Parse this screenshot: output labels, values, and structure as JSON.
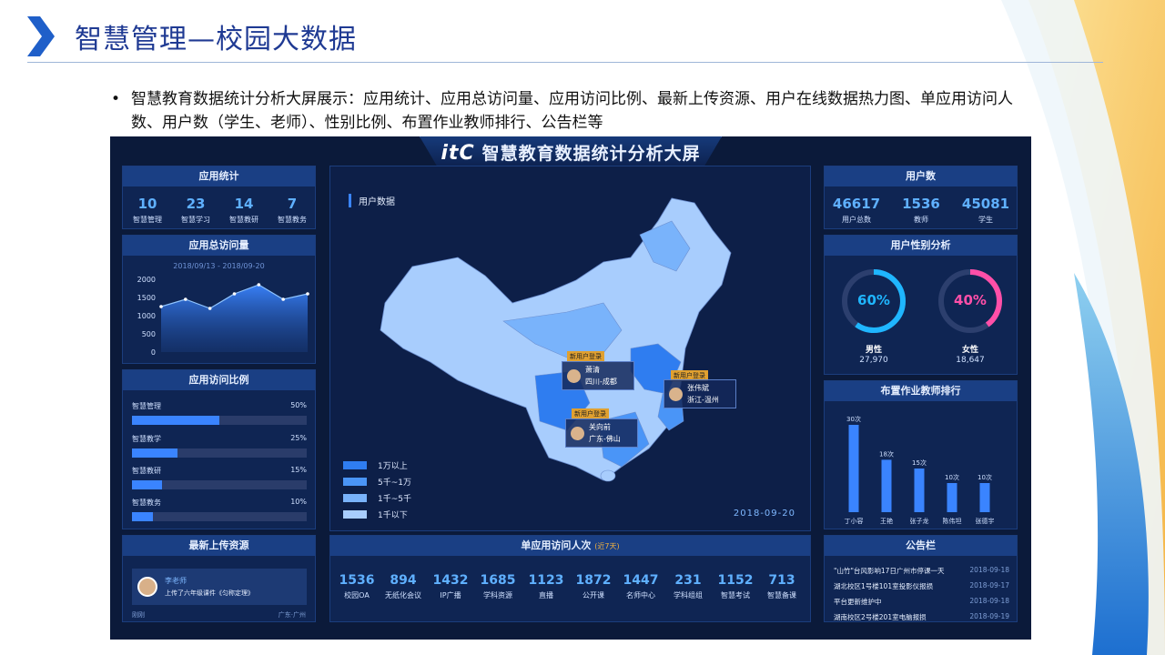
{
  "slide": {
    "title": "智慧管理—校园大数据",
    "bullet": "智慧教育数据统计分析大屏展示：应用统计、应用总访问量、应用访问比例、最新上传资源、用户在线数据热力图、单应用访问人数、用户数（学生、老师）、性别比例、布置作业教师排行、公告栏等"
  },
  "screen": {
    "logo": "itC",
    "title": "智慧教育数据统计分析大屏"
  },
  "app_stats": {
    "title": "应用统计",
    "items": [
      {
        "value": "10",
        "label": "智慧管理"
      },
      {
        "value": "23",
        "label": "智慧学习"
      },
      {
        "value": "14",
        "label": "智慧教研"
      },
      {
        "value": "7",
        "label": "智慧教务"
      }
    ]
  },
  "total_visits": {
    "title": "应用总访问量",
    "range": "2018/09/13 - 2018/09-20"
  },
  "visit_ratio": {
    "title": "应用访问比例",
    "items": [
      {
        "label": "智慧管理",
        "pct": "50%"
      },
      {
        "label": "智慧教学",
        "pct": "25%"
      },
      {
        "label": "智慧教研",
        "pct": "15%"
      },
      {
        "label": "智慧教务",
        "pct": "10%"
      }
    ]
  },
  "latest_upload": {
    "title": "最新上传资源",
    "user": "李老师",
    "desc": "上传了六年级课件《匀称定理》",
    "time": "刚刚",
    "place": "广东·广州"
  },
  "map": {
    "title": "用户数据",
    "date": "2018-09-20",
    "legend": [
      "1万以上",
      "5千~1万",
      "1千~5千",
      "1千以下"
    ],
    "legend_colors": [
      "#2f7df0",
      "#4a95f7",
      "#79b3fb",
      "#a8cdfd"
    ],
    "pins": [
      {
        "tag": "新用户登录",
        "name": "萧清",
        "place": "四川-成都"
      },
      {
        "tag": "新用户登录",
        "name": "张伟斌",
        "place": "浙江-温州"
      },
      {
        "tag": "新用户登录",
        "name": "关向前",
        "place": "广东-佛山"
      }
    ]
  },
  "single_app": {
    "title": "单应用访问人次",
    "subtitle": "(近7天)",
    "items": [
      {
        "value": "1536",
        "label": "校园OA"
      },
      {
        "value": "894",
        "label": "无纸化会议"
      },
      {
        "value": "1432",
        "label": "IP广播"
      },
      {
        "value": "1685",
        "label": "学科资源"
      },
      {
        "value": "1123",
        "label": "直播"
      },
      {
        "value": "1872",
        "label": "公开课"
      },
      {
        "value": "1447",
        "label": "名师中心"
      },
      {
        "value": "231",
        "label": "学科组组"
      },
      {
        "value": "1152",
        "label": "智慧考试"
      },
      {
        "value": "713",
        "label": "智慧备课"
      }
    ]
  },
  "user_count": {
    "title": "用户数",
    "items": [
      {
        "value": "46617",
        "label": "用户总数"
      },
      {
        "value": "1536",
        "label": "教师"
      },
      {
        "value": "45081",
        "label": "学生"
      }
    ]
  },
  "gender": {
    "title": "用户性别分析",
    "male": {
      "pct": "60%",
      "label": "男性",
      "count": "27,970",
      "fraction": 0.6,
      "color": "#1fb6ff"
    },
    "female": {
      "pct": "40%",
      "label": "女性",
      "count": "18,647",
      "fraction": 0.4,
      "color": "#ff4fa8"
    }
  },
  "homework_rank": {
    "title": "布置作业教师排行"
  },
  "notice": {
    "title": "公告栏",
    "items": [
      {
        "text": "\"山竹\"台风影响17日广州市停课一天",
        "date": "2018-09-18"
      },
      {
        "text": "湖北校区1号楼101室投影仪报损",
        "date": "2018-09-17"
      },
      {
        "text": "平台更新维护中",
        "date": "2018-09-18"
      },
      {
        "text": "湖南校区2号楼201室电脑报损",
        "date": "2018-09-19"
      }
    ]
  },
  "chart_data": [
    {
      "type": "area",
      "title": "2018/09/13 - 2018/09-20",
      "y_ticks": [
        "2000",
        "1500",
        "1000",
        "500",
        "0"
      ],
      "ylim": [
        0,
        2000
      ],
      "values": [
        1250,
        1450,
        1200,
        1600,
        1850,
        1450,
        1600
      ]
    },
    {
      "type": "bar",
      "categories": [
        "丁小容",
        "王艳",
        "张子龙",
        "陈伟坦",
        "张德宇"
      ],
      "values": [
        30,
        18,
        15,
        10,
        10
      ],
      "value_labels": [
        "30次",
        "18次",
        "15次",
        "10次",
        "10次"
      ],
      "ylim": [
        0,
        30
      ]
    }
  ]
}
